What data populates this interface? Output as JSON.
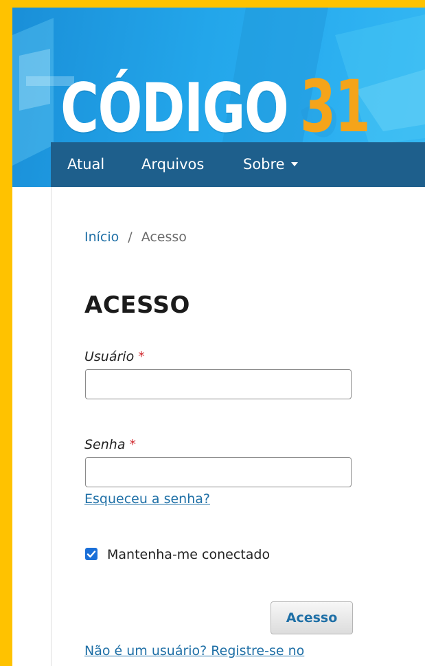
{
  "header": {
    "logo_word": "CÓDIGO",
    "logo_number": "31",
    "brand_colors": {
      "logo_word": "#FFFFFF",
      "logo_number": "#F5A41A",
      "banner": "#23A6EA",
      "navbar": "#1E5F8C"
    }
  },
  "nav": {
    "items": [
      {
        "label": "Atual"
      },
      {
        "label": "Arquivos"
      },
      {
        "label": "Sobre",
        "icon": "caret-down-icon"
      }
    ]
  },
  "breadcrumb": {
    "home": "Início",
    "separator": "/",
    "current": "Acesso"
  },
  "page": {
    "title": "ACESSO"
  },
  "form": {
    "username_label": "Usuário",
    "username_value": "",
    "password_label": "Senha",
    "password_value": "",
    "required_marker": "*",
    "forgot_password": "Esqueceu a senha?",
    "remember_me_label": "Mantenha-me conectado",
    "remember_me_checked": true,
    "submit_label": "Acesso",
    "register_link": "Não é um usuário? Registre-se no"
  }
}
